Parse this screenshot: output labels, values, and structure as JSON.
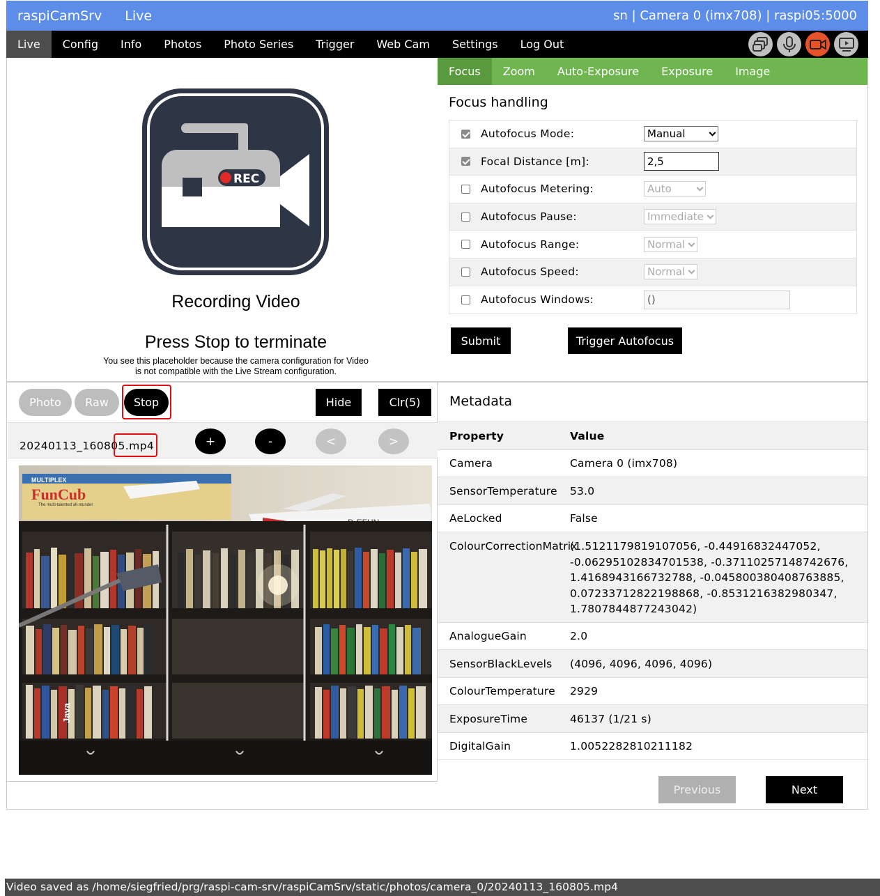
{
  "header": {
    "app_name": "raspiCamSrv",
    "page_name": "Live",
    "right_info": "sn | Camera 0 (imx708) | raspi05:5000"
  },
  "nav": {
    "items": [
      "Live",
      "Config",
      "Info",
      "Photos",
      "Photo Series",
      "Trigger",
      "Web Cam",
      "Settings",
      "Log Out"
    ],
    "active": "Live",
    "icons": [
      "multi-camera-icon",
      "microphone-icon",
      "video-record-icon",
      "video-preview-icon"
    ],
    "recording_color": "#e8522b"
  },
  "placeholder": {
    "badge_text": "REC",
    "title": "Recording Video",
    "subtitle": "Press Stop to terminate",
    "note_line1": "You see this placeholder because the camera configuration for Video",
    "note_line2": "is not compatible with the Live Stream configuration."
  },
  "subtabs": {
    "items": [
      "Focus",
      "Zoom",
      "Auto-Exposure",
      "Exposure",
      "Image"
    ],
    "active": "Focus",
    "color": "#6fb650"
  },
  "focus": {
    "title": "Focus handling",
    "rows": [
      {
        "label": "Autofocus Mode:",
        "checked": true,
        "value": "Manual"
      },
      {
        "label": "Focal Distance [m]:",
        "checked": true,
        "value": "2,5"
      },
      {
        "label": "Autofocus Metering:",
        "checked": false,
        "value": "Auto"
      },
      {
        "label": "Autofocus Pause:",
        "checked": false,
        "value": "Immediate"
      },
      {
        "label": "Autofocus Range:",
        "checked": false,
        "value": "Normal"
      },
      {
        "label": "Autofocus Speed:",
        "checked": false,
        "value": "Normal"
      },
      {
        "label": "Autofocus Windows:",
        "checked": false,
        "value": "()"
      }
    ],
    "submit_label": "Submit",
    "trigger_label": "Trigger Autofocus"
  },
  "capture": {
    "photo_label": "Photo",
    "raw_label": "Raw",
    "stop_label": "Stop",
    "hide_label": "Hide",
    "clear_label": "Clr(5)",
    "filename": "20240113_160805.mp4",
    "plus_label": "+",
    "minus_label": "-",
    "prev_label": "<",
    "next_label": ">",
    "photo_labels": {
      "brand": "MULTIPLEX",
      "model": "FunCub",
      "tagline": "The multi-talented all-rounder",
      "plane_reg": "D-EFUN",
      "book_java": "Java"
    }
  },
  "metadata": {
    "title": "Metadata",
    "header": {
      "property": "Property",
      "value": "Value"
    },
    "rows": [
      {
        "property": "Camera",
        "value": "Camera 0 (imx708)"
      },
      {
        "property": "SensorTemperature",
        "value": "53.0"
      },
      {
        "property": "AeLocked",
        "value": "False"
      },
      {
        "property": "ColourCorrectionMatrix",
        "value": "(1.5121179819107056, -0.44916832447052, -0.06295102834701538, -0.37110257148742676, 1.4168943166732788, -0.045800380408763885, 0.07233712822198868, -0.8531216382980347, 1.7807844877243042)"
      },
      {
        "property": "AnalogueGain",
        "value": "2.0"
      },
      {
        "property": "SensorBlackLevels",
        "value": "(4096, 4096, 4096, 4096)"
      },
      {
        "property": "ColourTemperature",
        "value": "2929"
      },
      {
        "property": "ExposureTime",
        "value": "46137 (1/21 s)"
      },
      {
        "property": "DigitalGain",
        "value": "1.0052282810211182"
      }
    ],
    "previous_label": "Previous",
    "next_label": "Next"
  },
  "status": {
    "message": "Video saved as /home/siegfried/prg/raspi-cam-srv/raspiCamSrv/static/photos/camera_0/20240113_160805.mp4"
  }
}
